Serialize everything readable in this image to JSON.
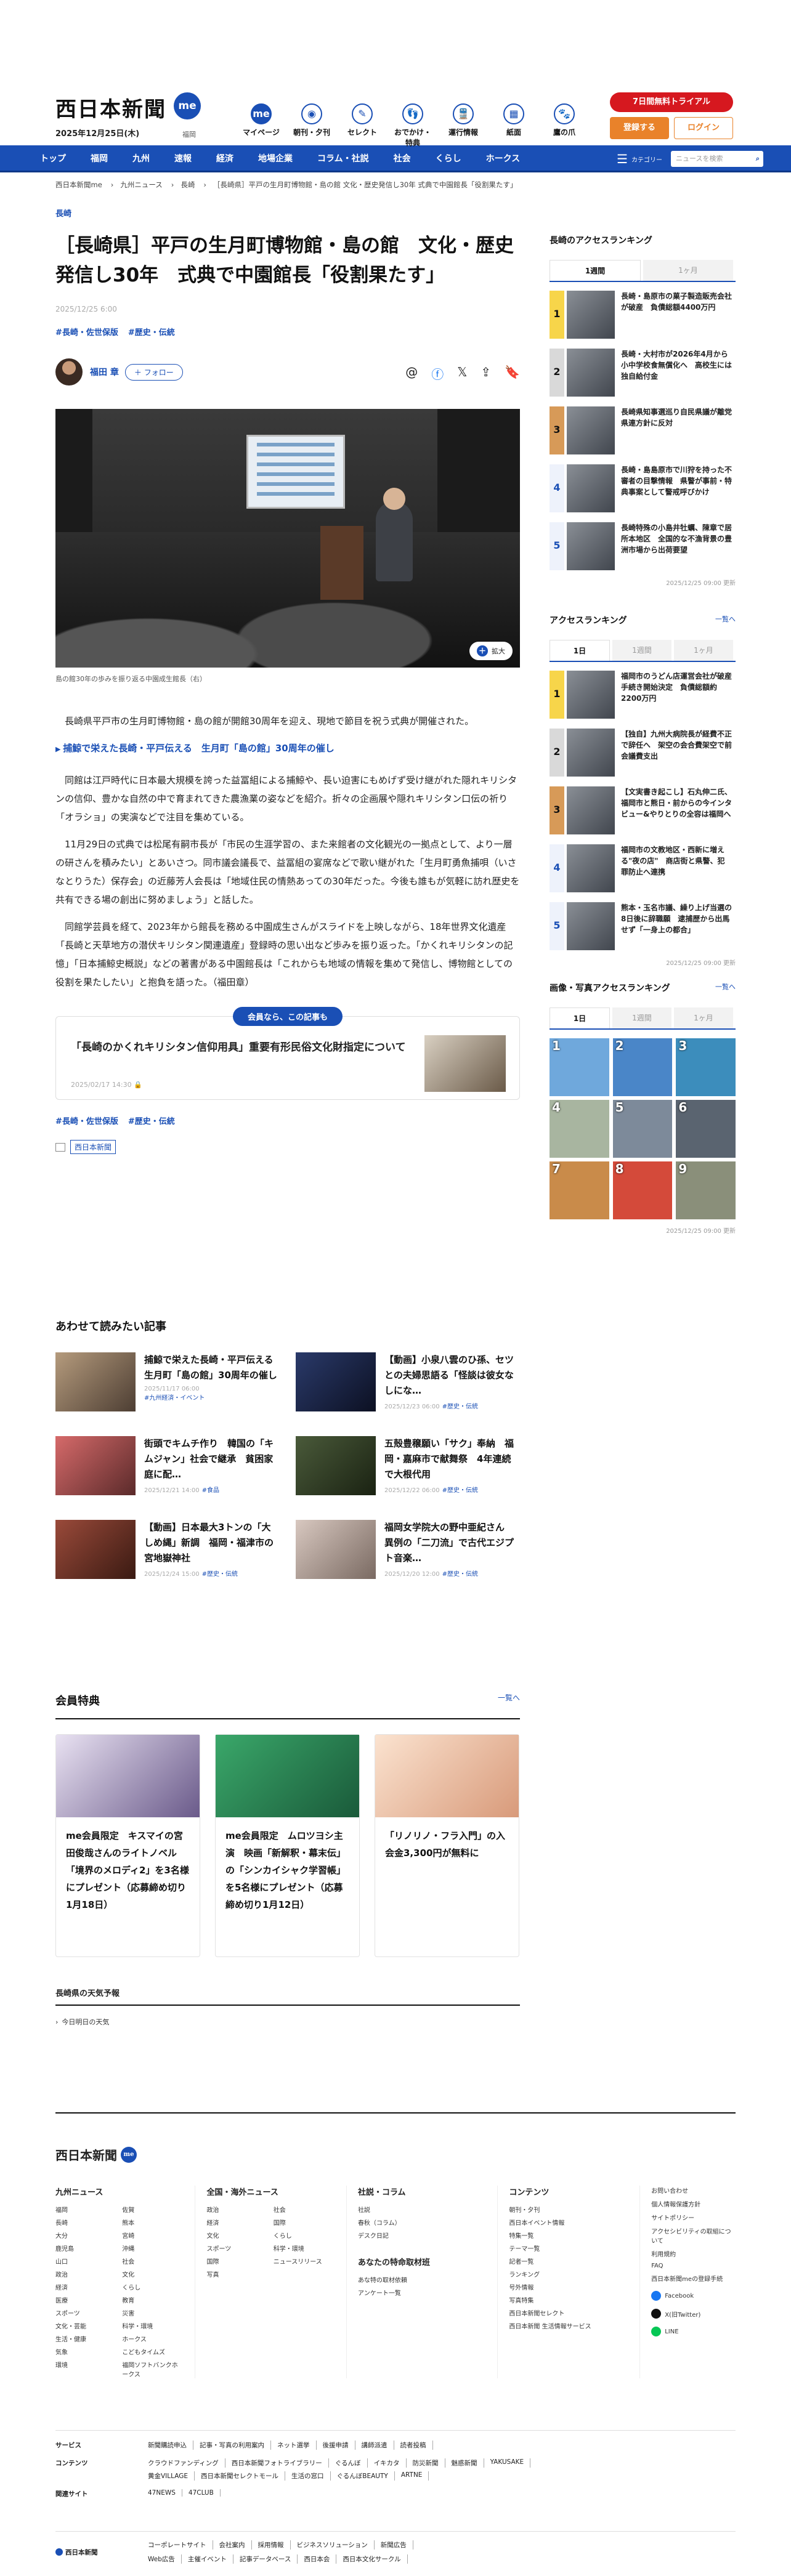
{
  "header": {
    "logo": "西日本新聞",
    "me": "me",
    "date": "2025年12月25日(木)",
    "pref": "福岡",
    "icons": [
      {
        "label": "マイページ",
        "icon": "me-icon"
      },
      {
        "label": "朝刊・夕刊",
        "icon": "newspaper-icon"
      },
      {
        "label": "セレクト",
        "icon": "select-icon"
      },
      {
        "label": "おでかけ・特典",
        "icon": "footprint-icon"
      },
      {
        "label": "運行情報",
        "icon": "train-icon"
      },
      {
        "label": "紙面",
        "icon": "paper-icon"
      },
      {
        "label": "鷹の爪",
        "icon": "hawks-icon"
      }
    ],
    "trial": "7日間無料トライアル",
    "register": "登録する",
    "login": "ログイン"
  },
  "nav": {
    "items": [
      "トップ",
      "福岡",
      "九州",
      "速報",
      "経済",
      "地場企業",
      "コラム・社説",
      "社会",
      "くらし",
      "ホークス"
    ],
    "category": "カテゴリー",
    "search_placeholder": "ニュースを検索"
  },
  "breadcrumb": [
    "西日本新聞me",
    "九州ニュース",
    "長崎",
    "［長崎県］平戸の生月町博物館・島の館 文化・歴史発信し30年 式典で中園館長「役割果たす」"
  ],
  "article": {
    "category": "長崎",
    "title": "［長崎県］平戸の生月町博物館・島の館　文化・歴史発信し30年　式典で中園館長「役割果たす」",
    "date": "2025/12/25 6:00",
    "tags": [
      "#長崎・佐世保版",
      "#歴史・伝統"
    ],
    "author": "福田 章",
    "follow": "＋ フォロー",
    "zoom": "拡大",
    "caption": "島の館30年の歩みを振り返る中園成生館長（右）",
    "p1": "長崎県平戸市の生月町博物館・島の館が開館30周年を迎え、現地で節目を祝う式典が開催された。",
    "related": "捕鯨で栄えた長崎・平戸伝える　生月町「島の館」30周年の催し",
    "p2": "同館は江戸時代に日本最大規模を誇った益冨組による捕鯨や、長い迫害にもめげず受け継がれた隠れキリシタンの信仰、豊かな自然の中で育まれてきた農漁業の姿などを紹介。折々の企画展や隠れキリシタン口伝の祈り「オラショ」の実演などで注目を集めている。",
    "p3": "11月29日の式典では松尾有嗣市長が「市民の生涯学習の、また来館者の文化観光の一拠点として、より一層の研さんを積みたい」とあいさつ。同市議会議長で、益冨組の宴席などで歌い継がれた「生月町勇魚捕唄（いさなとりうた）保存会」の近藤芳人会長は「地域住民の情熱あっての30年だった。今後も誰もが気軽に訪れ歴史を共有できる場の創出に努めましょう」と話した。",
    "p4": "同館学芸員を経て、2023年から館長を務める中園成生さんがスライドを上映しながら、18年世界文化遺産「長崎と天草地方の潜伏キリシタン関連遺産」登録時の思い出など歩みを振り返った。「かくれキリシタンの記憶」「日本捕鯨史概説」などの著書がある中園館長は「これからも地域の情報を集めて発信し、博物館としての役割を果たしたい」と抱負を語った。（福田章）",
    "member_pill": "会員なら、この記事も",
    "member_title": "「長崎のかくれキリシタン信仰用具」重要有形民俗文化財指定について",
    "member_date": "2025/02/17 14:30 🔒",
    "source": "西日本新聞"
  },
  "sidebar": {
    "access_title": "長崎のアクセスランキング",
    "tabs1": [
      "1週間",
      "1ヶ月"
    ],
    "rank1": [
      "長崎・島原市の菓子製造販売会社が破産　負債総額4400万円",
      "長崎・大村市が2026年4月から小中学校食無償化へ　高校生には独自給付金",
      "長崎県知事選巡り自民県議が離党　県連方針に反対",
      "長崎・島島原市で川狩を持った不審者の目撃情報　県警が事前・特典事案として警戒呼びかけ",
      "長崎特殊の小島井牡蠣、陳章で居所本地区　全国的な不漁背景の豊洲市場から出荷要望"
    ],
    "upd1": "2025/12/25 09:00 更新",
    "access2": "アクセスランキング",
    "more": "一覧へ",
    "tabs2": [
      "1日",
      "1週間",
      "1ヶ月"
    ],
    "rank2": [
      "福岡市のうどん店運営会社が破産手続き開始決定　負債総額約2200万円",
      "【独自】九州大病院長が経費不正で辞任へ　架空の会合費架空で前会議費支出",
      "【文実書き起こし】石丸伸二氏、福岡市と熊日・前からの今インタビュー&やりとりの全容は福岡へ",
      "福岡市の文教地区・西新に増える\"夜の店\"　商店街と県警、犯罪防止へ連携",
      "熊本・玉名市議、繰り上げ当選の8日後に辞職願　逮捕歴から出馬せず「一身上の都合」"
    ],
    "upd2": "2025/12/25 09:00 更新",
    "photo_title": "画像・写真アクセスランキング",
    "tabs3": [
      "1日",
      "1週間",
      "1ヶ月"
    ],
    "upd3": "2025/12/25 09:00 更新"
  },
  "recs": {
    "title": "あわせて読みたい記事",
    "items": [
      {
        "t": "捕鯨で栄えた長崎・平戸伝える　生月町「島の館」30周年の催し",
        "d": "2025/11/17 06:00",
        "tag": "#九州経済・イベント"
      },
      {
        "t": "【動画】小泉八雲のひ孫、セツとの夫婦思語る「怪談は彼女なしにな…",
        "d": "2025/12/23 06:00",
        "tag": "#歴史・伝統"
      },
      {
        "t": "街頭でキムチ作り　韓国の「キムジャン」社会で継承　貧困家庭に配…",
        "d": "2025/12/21 14:00",
        "tag": "#食品"
      },
      {
        "t": "五殻豊穣願い「サク」奉納　福岡・嘉麻市で献舞祭　4年連続で大根代用",
        "d": "2025/12/22 06:00",
        "tag": "#歴史・伝統"
      },
      {
        "t": "【動画】日本最大3トンの「大しめ縄」新調　福岡・福津市の宮地嶽神社",
        "d": "2025/12/24 15:00",
        "tag": "#歴史・伝統"
      },
      {
        "t": "福岡女学院大の野中亜紀さん　異例の「二刀流」で古代エジプト音楽…",
        "d": "2025/12/20 12:00",
        "tag": "#歴史・伝統"
      }
    ]
  },
  "perks": {
    "title": "会員特典",
    "more": "一覧へ",
    "items": [
      "me会員限定　キスマイの宮田俊哉さんのライトノベル「境界のメロディ2」を3名様にプレゼント（応募締め切り1月18日）",
      "me会員限定　ムロツヨシ主演　映画「新解釈・幕末伝」の「シンカイシャク学習帳」を5名様にプレゼント（応募締め切り1月12日）",
      "「リノリノ・フラ入門」の入会金3,300円が無料に"
    ]
  },
  "weather": {
    "title": "長崎県の天気予報",
    "item": "今日明日の天気"
  },
  "footer": {
    "logo": "西日本新聞",
    "me": "me",
    "cols": [
      {
        "h": "九州ニュース",
        "links": [
          "福岡",
          "佐賀",
          "長崎",
          "熊本",
          "大分",
          "宮崎",
          "鹿児島",
          "沖縄",
          "山口",
          "社会",
          "政治",
          "文化",
          "経済",
          "くらし",
          "医療",
          "教育",
          "スポーツ",
          "災害",
          "文化・芸能",
          "科学・環境",
          "生活・健康",
          "ホークス",
          "気象",
          "こどもタイムズ",
          "環境",
          "福岡ソフトバンクホークス"
        ]
      },
      {
        "h": "全国・海外ニュース",
        "links": [
          "政治",
          "社会",
          "経済",
          "国際",
          "文化",
          "くらし",
          "スポーツ",
          "科学・環境",
          "国際",
          "ニュースリリース",
          "写真"
        ]
      },
      {
        "h": "社説・コラム",
        "links": [
          "社説",
          "春秋（コラム）",
          "デスク日記"
        ],
        "h2": "あなたの特命取材班",
        "links2": [
          "あな特の取材依頼",
          "アンケート一覧"
        ]
      },
      {
        "h": "コンテンツ",
        "links": [
          "朝刊・夕刊",
          "西日本イベント情報",
          "特集一覧",
          "テーマ一覧",
          "記者一覧",
          "ランキング",
          "号外情報",
          "写真特集",
          "西日本新聞セレクト",
          "西日本新聞 生活情報サービス"
        ]
      }
    ],
    "side": [
      "お問い合わせ",
      "個人情報保護方針",
      "サイトポリシー",
      "アクセシビリティの取組について",
      "利用規約",
      "FAQ",
      "西日本新聞meの登録手続"
    ],
    "social": [
      "Facebook",
      "X(旧Twitter)",
      "LINE"
    ],
    "rows": [
      {
        "h": "サービス",
        "items": [
          "新聞購読申込",
          "記事・写真の利用案内",
          "ネット選挙",
          "後援申請",
          "講師派遣",
          "読者投稿"
        ]
      },
      {
        "h": "コンテンツ",
        "items": [
          "クラウドファンディング",
          "西日本新聞フォトライブラリー",
          "ぐるんぼ",
          "イキカタ",
          "防災新聞",
          "魅惑新聞",
          "YAKUSAKE",
          "黄金VILLAGE",
          "西日本新聞セレクトモール",
          "生活の窓口",
          "ぐるんぼBEAUTY",
          "ARTNE"
        ]
      },
      {
        "h": "関連サイト",
        "items": [
          "47NEWS",
          "47CLUB"
        ]
      }
    ],
    "bottom_logo": "西日本新聞",
    "bottom": [
      "コーポレートサイト",
      "会社案内",
      "採用情報",
      "ビジネスソリューション",
      "新聞広告",
      "Web広告",
      "主催イベント",
      "記事データベース",
      "西日本会",
      "西日本文化サークル"
    ]
  }
}
